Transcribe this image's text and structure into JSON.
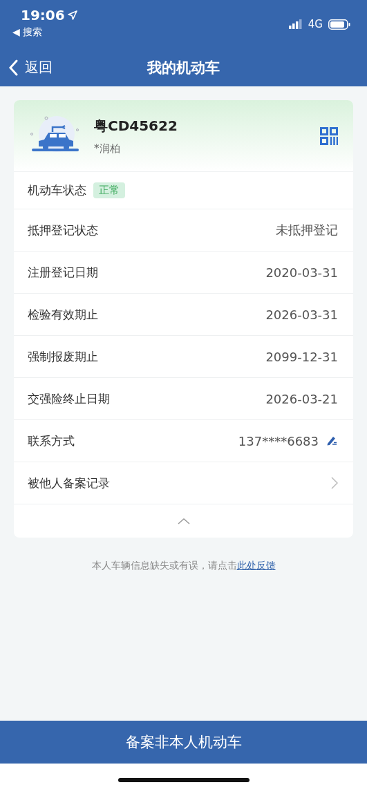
{
  "status_bar": {
    "time": "19:06",
    "back_app": "◀ 搜索",
    "network": "4G"
  },
  "nav": {
    "back": "返回",
    "title": "我的机动车"
  },
  "vehicle": {
    "plate": "粤CD45622",
    "owner": "*润柏"
  },
  "rows": [
    {
      "kind": "badge",
      "label": "机动车状态",
      "badge": "正常"
    },
    {
      "kind": "text",
      "label": "抵押登记状态",
      "value": "未抵押登记"
    },
    {
      "kind": "text",
      "label": "注册登记日期",
      "value": "2020-03-31"
    },
    {
      "kind": "text",
      "label": "检验有效期止",
      "value": "2026-03-31"
    },
    {
      "kind": "text",
      "label": "强制报废期止",
      "value": "2099-12-31"
    },
    {
      "kind": "text",
      "label": "交强险终止日期",
      "value": "2026-03-21"
    },
    {
      "kind": "editable",
      "label": "联系方式",
      "value": "137****6683"
    },
    {
      "kind": "link",
      "label": "被他人备案记录"
    }
  ],
  "feedback": {
    "text": "本人车辆信息缺失或有误，请点击",
    "link": "此处反馈"
  },
  "bottom_button": "备案非本人机动车"
}
